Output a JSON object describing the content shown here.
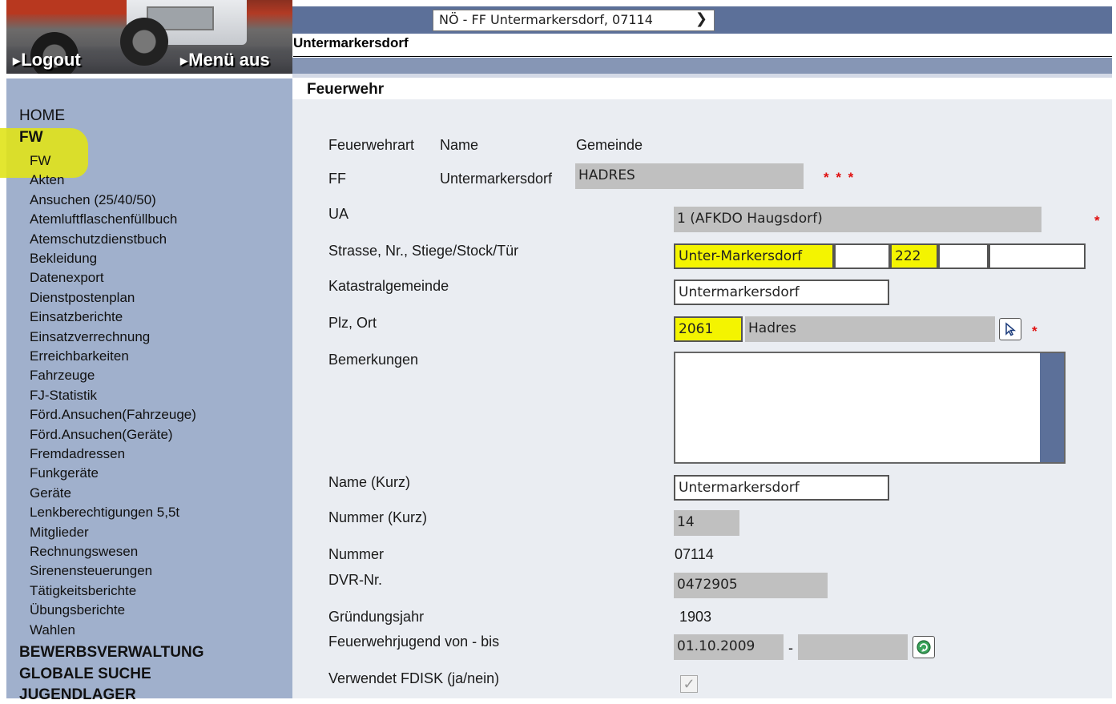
{
  "header": {
    "logout": "Logout",
    "menu_toggle": "Menü aus",
    "fw_select": "NÖ - FF Untermarkersdorf, 07114",
    "title": "Untermarkersdorf"
  },
  "sidebar": {
    "home": "HOME",
    "fw": "FW",
    "items": [
      "FW",
      "Akten",
      "Ansuchen (25/40/50)",
      "Atemluftflaschenfüllbuch",
      "Atemschutzdienstbuch",
      "Bekleidung",
      "Datenexport",
      "Dienstpostenplan",
      "Einsatzberichte",
      "Einsatzverrechnung",
      "Erreichbarkeiten",
      "Fahrzeuge",
      "FJ-Statistik",
      "Förd.Ansuchen(Fahrzeuge)",
      "Förd.Ansuchen(Geräte)",
      "Fremdadressen",
      "Funkgeräte",
      "Geräte",
      "Lenkberechtigungen 5,5t",
      "Mitglieder",
      "Rechnungswesen",
      "Sirenensteuerungen",
      "Tätigkeitsberichte",
      "Übungsberichte",
      "Wahlen"
    ],
    "sections": [
      "BEWERBSVERWALTUNG",
      "GLOBALE SUCHE",
      "JUGENDLAGER"
    ]
  },
  "form": {
    "title": "Feuerwehr",
    "hdr_art": "Feuerwehrart",
    "hdr_name": "Name",
    "hdr_gemeinde": "Gemeinde",
    "art": "FF",
    "name": "Untermarkersdorf",
    "gemeinde": "HADRES",
    "req3": "* * *",
    "req": "*",
    "ua_label": "UA",
    "ua_value": "1 (AFKDO Haugsdorf)",
    "strasse_label": "Strasse, Nr., Stiege/Stock/Tür",
    "strasse": "Unter-Markersdorf",
    "nr": "222",
    "stiege": "",
    "kg_label": "Katastralgemeinde",
    "kg": "Untermarkersdorf",
    "plz_label": "Plz, Ort",
    "plz": "2061",
    "ort": "Hadres",
    "bem_label": "Bemerkungen",
    "bem": "",
    "namekurz_label": "Name (Kurz)",
    "namekurz": "Untermarkersdorf",
    "nummerkurz_label": "Nummer (Kurz)",
    "nummerkurz": "14",
    "nummer_label": "Nummer",
    "nummer": "07114",
    "dvr_label": "DVR-Nr.",
    "dvr": "0472905",
    "gj_label": "Gründungsjahr",
    "gj": "1903",
    "fj_label": "Feuerwehrjugend von - bis",
    "fj_von": "01.10.2009",
    "fj_sep": "-",
    "fj_bis": "",
    "fdisk_label": "Verwendet FDISK (ja/nein)",
    "fdisk_checked": "✓"
  },
  "colors": {
    "highlight": "#f4f400",
    "topbar": "#5c7099",
    "sidebar": "#a0b0cc",
    "required": "#e01010"
  }
}
